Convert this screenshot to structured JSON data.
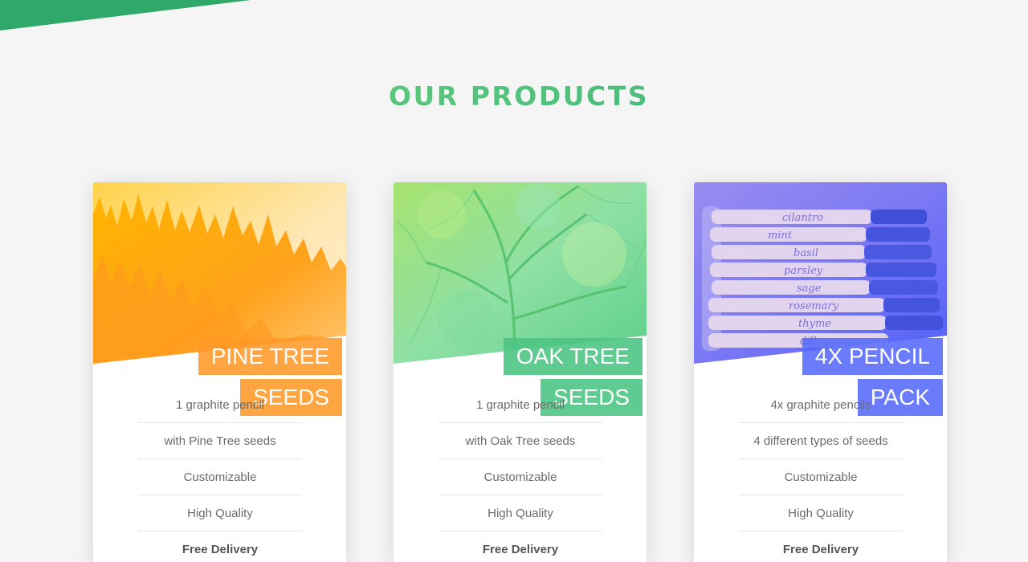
{
  "section": {
    "title": "OUR PRODUCTS"
  },
  "colors": {
    "title_gradient": [
      "#6ecf78",
      "#3daa73"
    ],
    "banner": "#2fa86a",
    "pine_tag": "#ff9928",
    "oak_tag": "#4ac482",
    "pack_tag": "#5569fa"
  },
  "products": [
    {
      "title_line1": "PINE TREE",
      "title_line2": "SEEDS",
      "image": "pine-forest-image",
      "features": [
        "1 graphite pencil",
        "with Pine Tree seeds",
        "Customizable",
        "High Quality",
        "Free Delivery"
      ]
    },
    {
      "title_line1": "OAK TREE",
      "title_line2": "SEEDS",
      "image": "oak-tree-image",
      "features": [
        "1 graphite pencil",
        "with Oak Tree seeds",
        "Customizable",
        "High Quality",
        "Free Delivery"
      ]
    },
    {
      "title_line1": "4X PENCIL",
      "title_line2": "PACK",
      "image": "pencil-pack-image",
      "features": [
        "4x graphite pencils",
        "4 different types of seeds",
        "Customizable",
        "High Quality",
        "Free Delivery"
      ],
      "pencil_labels": [
        "cilantro",
        "mint",
        "basil",
        "parsley",
        "sage",
        "rosemary",
        "thyme",
        "dill"
      ]
    }
  ]
}
